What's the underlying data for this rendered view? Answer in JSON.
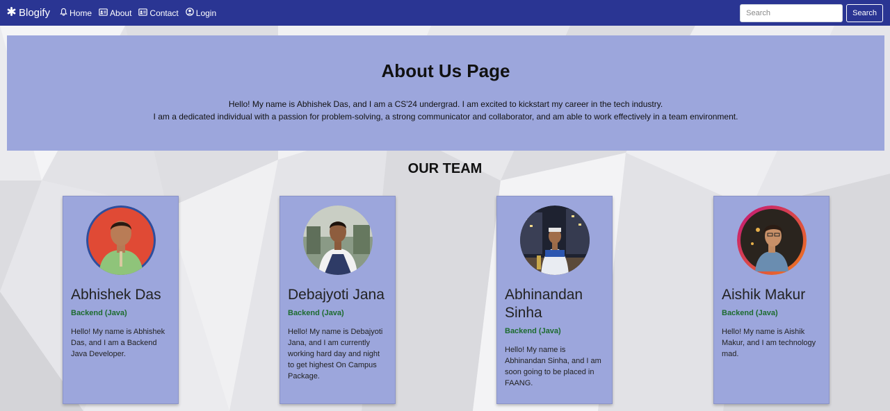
{
  "navbar": {
    "brand": "Blogify",
    "links": [
      {
        "label": "Home",
        "icon": "bell-icon"
      },
      {
        "label": "About",
        "icon": "id-card-icon"
      },
      {
        "label": "Contact",
        "icon": "contact-card-icon"
      },
      {
        "label": "Login",
        "icon": "user-circle-icon"
      }
    ],
    "search_placeholder": "Search",
    "search_button": "Search"
  },
  "about": {
    "title": "About Us Page",
    "line1": "Hello! My name is Abhishek Das, and I am a CS'24 undergrad. I am excited to kickstart my career in the tech industry.",
    "line2": "I am a dedicated individual with a passion for problem-solving, a strong communicator and collaborator, and am able to work effectively in a team environment."
  },
  "team": {
    "title": "OUR TEAM",
    "members": [
      {
        "name": "Abhishek Das",
        "role": "Backend (Java)",
        "bio": "Hello! My name is Abhishek Das, and I am a Backend Java Developer."
      },
      {
        "name": "Debajyoti Jana",
        "role": "Backend (Java)",
        "bio": "Hello! My name is Debajyoti Jana, and I am currently working hard day and night to get highest On Campus Package."
      },
      {
        "name": "Abhinandan Sinha",
        "role": "Backend (Java)",
        "bio": "Hello! My name is Abhinandan Sinha, and I am soon going to be placed in FAANG."
      },
      {
        "name": "Aishik Makur",
        "role": "Backend (Java)",
        "bio": "Hello! My name is Aishik Makur, and I am technology mad."
      }
    ]
  },
  "colors": {
    "navbar": "#2a3593",
    "panel": "#9ca6dc",
    "role": "#1d6b2f"
  }
}
